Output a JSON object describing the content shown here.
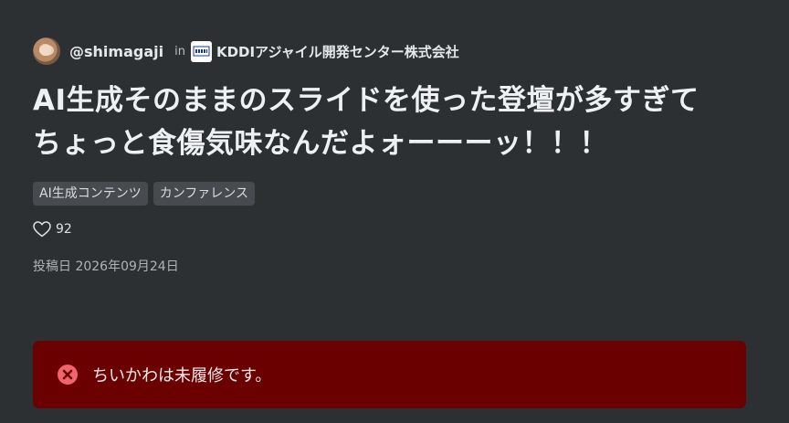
{
  "author": {
    "username": "@shimagaji",
    "in_label": "in",
    "org_logo_icon": "kddi-logo-icon",
    "org_name": "KDDIアジャイル開発センター株式会社"
  },
  "title": {
    "line1": "AI生成そのままのスライドを使った登壇が多すぎて",
    "line2": "ちょっと食傷気味なんだよォーーーッ！！！"
  },
  "tags": [
    {
      "label": "AI生成コンテンツ"
    },
    {
      "label": "カンファレンス"
    }
  ],
  "likes": {
    "icon": "heart-icon",
    "count": "92"
  },
  "posted": {
    "label": "投稿日",
    "date": "2026年09月24日"
  },
  "alert": {
    "icon": "error-circle-icon",
    "message": "ちいかわは未履修です。",
    "background_color": "#6a0000",
    "icon_color": "#f0646e"
  },
  "colors": {
    "page_background": "#2d3032",
    "tag_background": "#474b4f"
  }
}
